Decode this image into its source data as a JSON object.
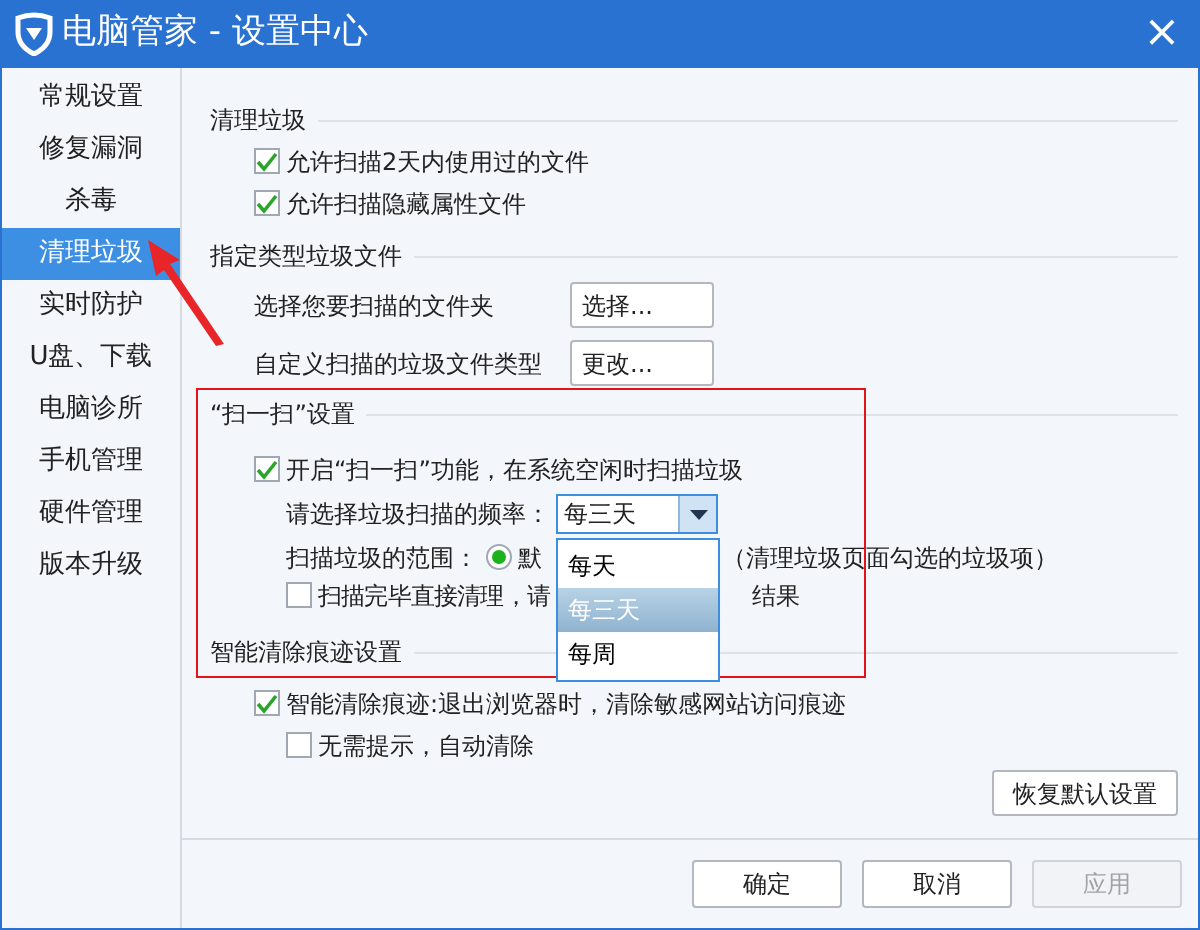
{
  "window": {
    "title": "电脑管家 - 设置中心",
    "close": "×"
  },
  "sidebar": {
    "items": [
      {
        "label": "常规设置",
        "selected": false
      },
      {
        "label": "修复漏洞",
        "selected": false
      },
      {
        "label": "杀毒",
        "selected": false
      },
      {
        "label": "清理垃圾",
        "selected": true
      },
      {
        "label": "实时防护",
        "selected": false
      },
      {
        "label": "U盘、下载",
        "selected": false
      },
      {
        "label": "电脑诊所",
        "selected": false
      },
      {
        "label": "手机管理",
        "selected": false
      },
      {
        "label": "硬件管理",
        "selected": false
      },
      {
        "label": "版本升级",
        "selected": false
      }
    ]
  },
  "sections": [
    {
      "title": "清理垃圾",
      "rows": [
        {
          "kind": "checkbox",
          "label": "允许扫描2天内使用过的文件",
          "checked": true
        },
        {
          "kind": "checkbox",
          "label": "允许扫描隐藏属性文件",
          "checked": true
        }
      ]
    },
    {
      "title": "指定类型垃圾文件",
      "rows": [
        {
          "kind": "button_row",
          "label": "选择您要扫描的文件夹",
          "button": "选择..."
        },
        {
          "kind": "button_row",
          "label": "自定义扫描的垃圾文件类型",
          "button": "更改..."
        }
      ]
    },
    {
      "title": "“扫一扫”设置",
      "rows": [
        {
          "kind": "checkbox",
          "label": "开启“扫一扫”功能，在系统空闲时扫描垃圾",
          "checked": true,
          "children": [
            {
              "kind": "select",
              "label": "请选择垃圾扫描的频率：",
              "value": "每三天",
              "expanded": true,
              "options": [
                {
                  "label": "每天",
                  "selected": false
                },
                {
                  "label": "每三天",
                  "selected": true
                },
                {
                  "label": "每周",
                  "selected": false
                }
              ]
            },
            {
              "kind": "radio",
              "label": "扫描垃圾的范围：",
              "option_start": "默",
              "option_end": "（清理垃圾页面勾选的垃圾项）",
              "selected": true
            },
            {
              "kind": "checkbox",
              "label": "扫描完毕直接清理，请",
              "label_end": "结果",
              "checked": false
            }
          ]
        }
      ]
    },
    {
      "title": "智能清除痕迹设置",
      "rows": [
        {
          "kind": "checkbox",
          "label": "智能清除痕迹:退出浏览器时，清除敏感网站访问痕迹",
          "checked": true,
          "children": [
            {
              "kind": "checkbox",
              "label": "无需提示，自动清除",
              "checked": false
            }
          ]
        }
      ]
    }
  ],
  "restore_button": "恢复默认设置",
  "footer_buttons": [
    {
      "label": "确定",
      "disabled": false
    },
    {
      "label": "取消",
      "disabled": false
    },
    {
      "label": "应用",
      "disabled": true
    }
  ]
}
